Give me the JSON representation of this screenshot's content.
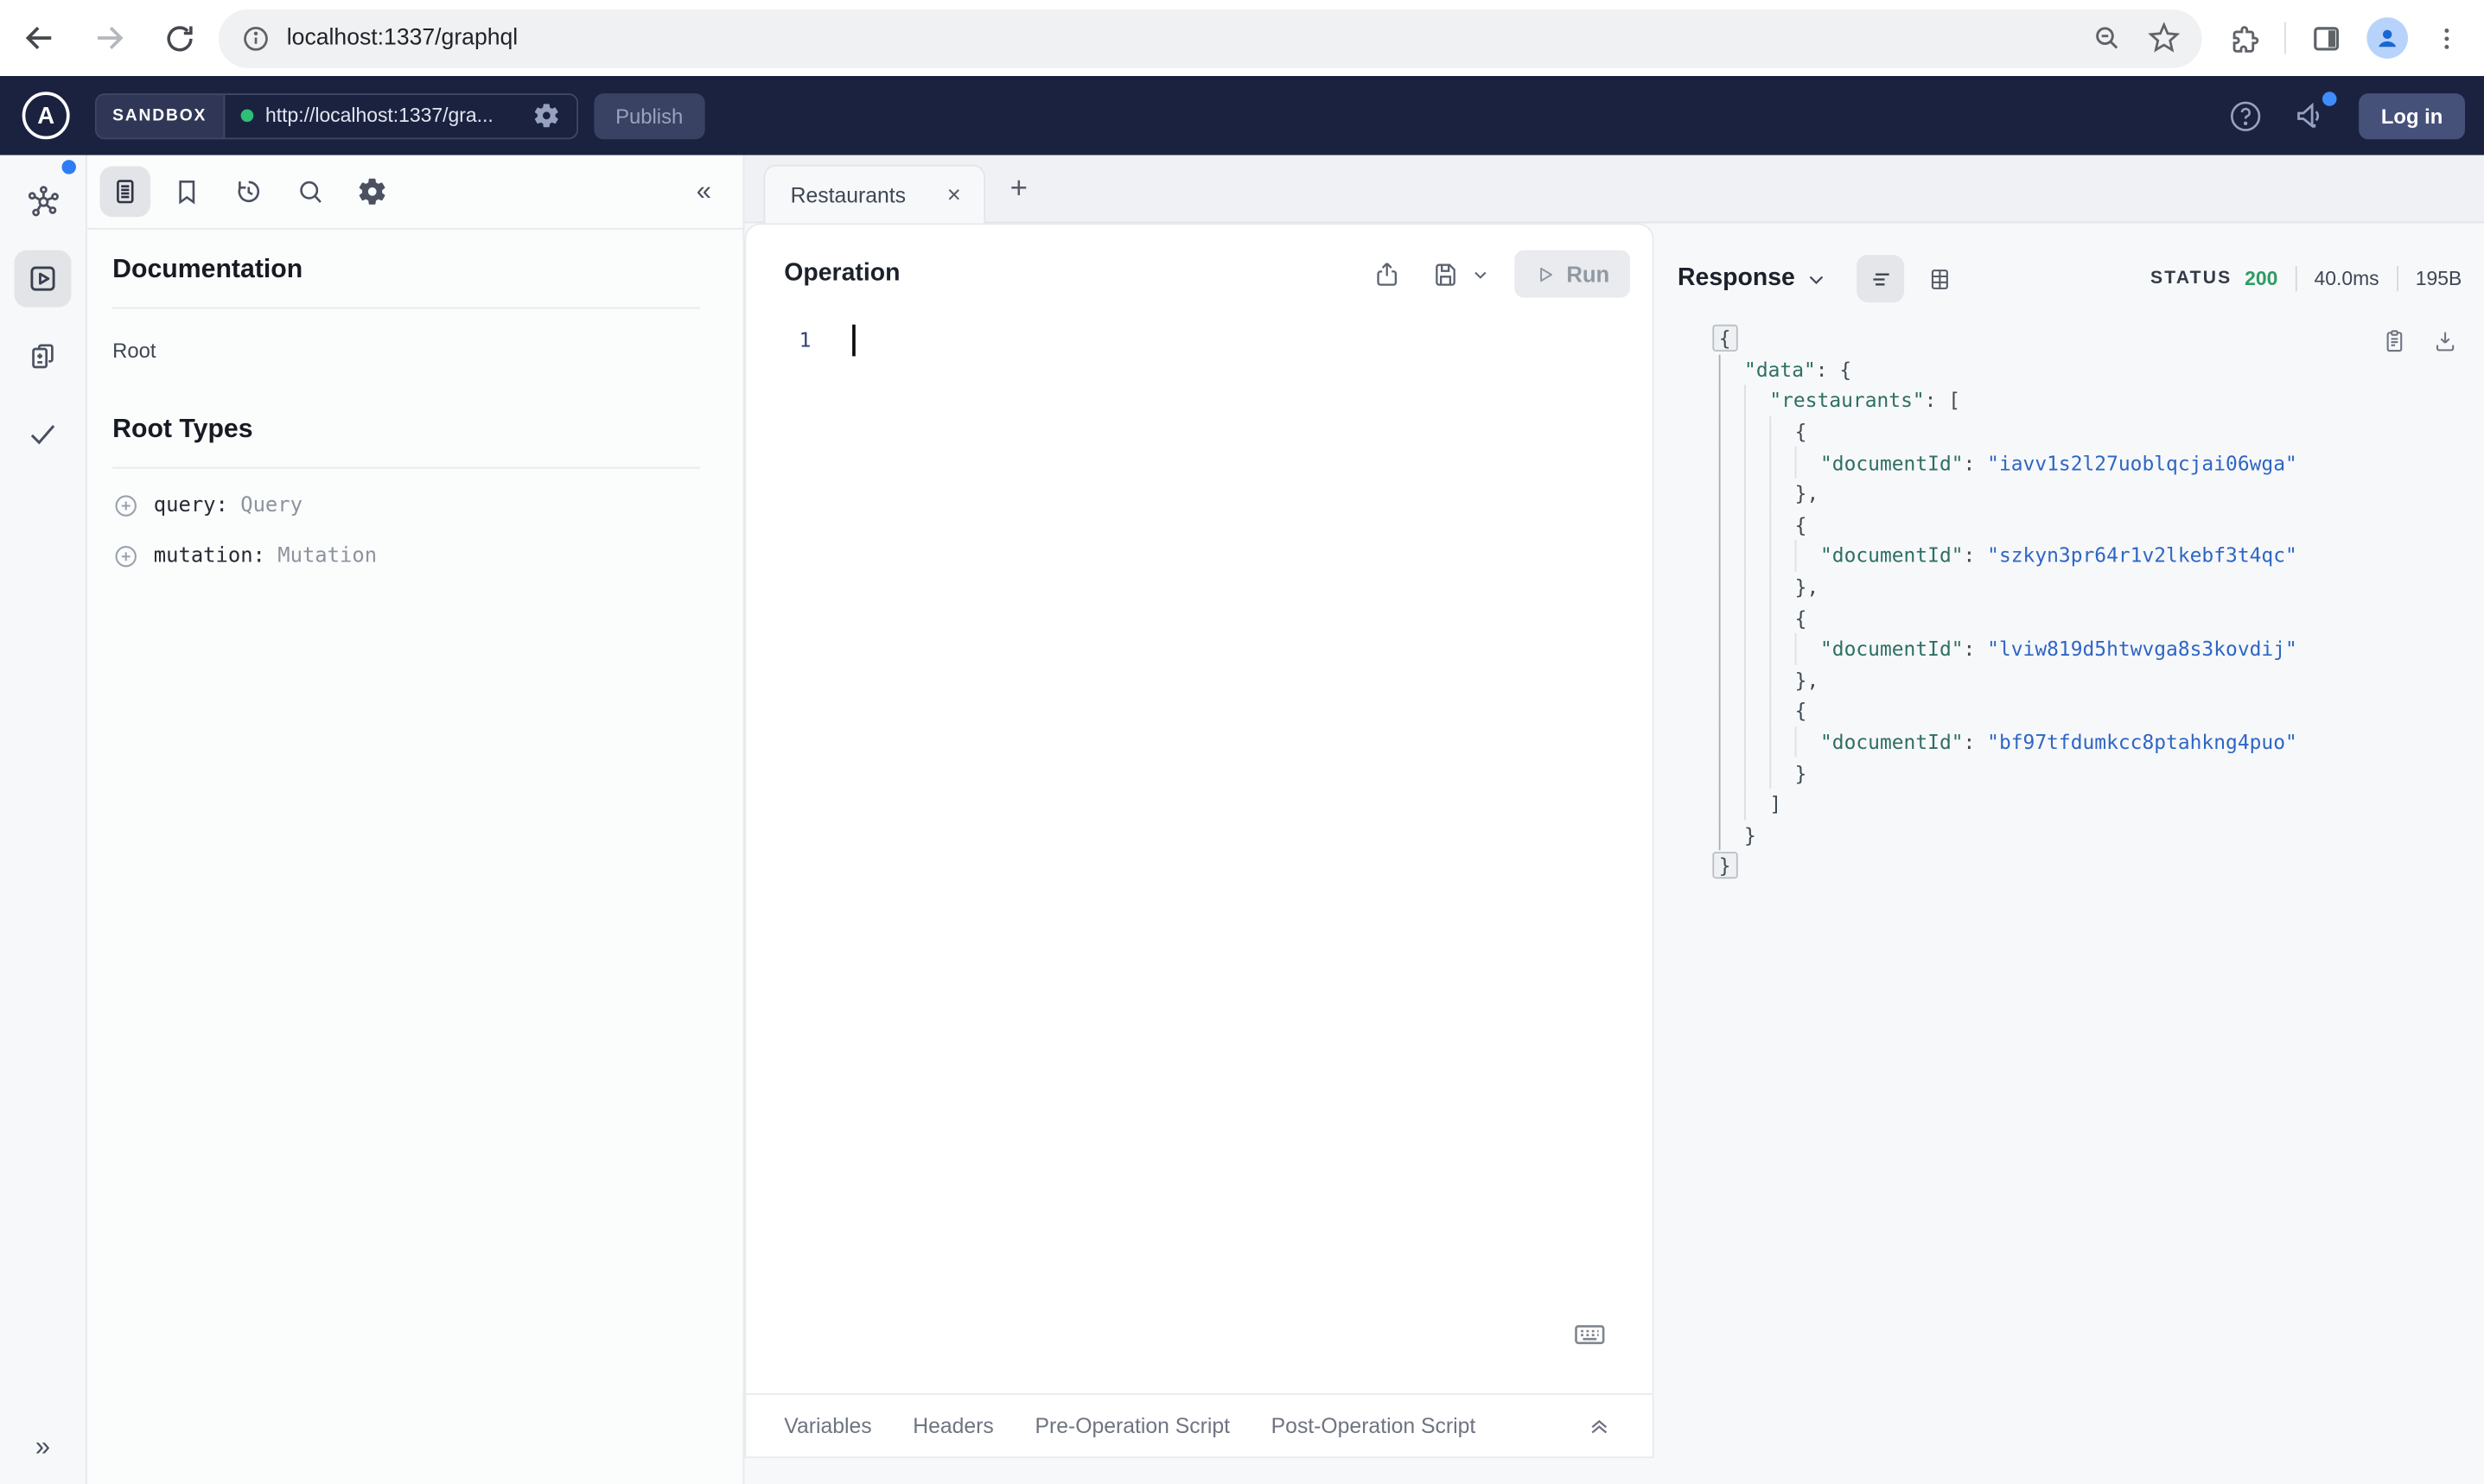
{
  "browser": {
    "url": "localhost:1337/graphql"
  },
  "header": {
    "brand_letter": "A",
    "badge": "SANDBOX",
    "endpoint": "http://localhost:1337/gra...",
    "publish": "Publish",
    "login": "Log in"
  },
  "docs": {
    "title": "Documentation",
    "root": "Root",
    "root_types": "Root Types",
    "types": [
      {
        "field": "query:",
        "type": "Query"
      },
      {
        "field": "mutation:",
        "type": "Mutation"
      }
    ]
  },
  "tabs": {
    "active": "Restaurants"
  },
  "operation": {
    "title": "Operation",
    "run": "Run",
    "line_number": "1"
  },
  "bottom_tabs": [
    "Variables",
    "Headers",
    "Pre-Operation Script",
    "Post-Operation Script"
  ],
  "response": {
    "title": "Response",
    "status_label": "STATUS",
    "status_code": "200",
    "time": "40.0ms",
    "size": "195B",
    "document_ids": [
      "iavv1s2l27uoblqcjai06wga",
      "szkyn3pr64r1v2lkebf3t4qc",
      "lviw819d5htwvga8s3kovdij",
      "bf97tfdumkcc8ptahkng4puo"
    ],
    "lines": [
      {
        "ind": 0,
        "seg": [
          {
            "c": "h",
            "t": "{"
          }
        ]
      },
      {
        "ind": 1,
        "seg": [
          {
            "c": "k",
            "t": "\"data\""
          },
          {
            "c": "p",
            "t": ": {"
          }
        ]
      },
      {
        "ind": 2,
        "seg": [
          {
            "c": "k",
            "t": "\"restaurants\""
          },
          {
            "c": "p",
            "t": ": ["
          }
        ]
      },
      {
        "ind": 3,
        "seg": [
          {
            "c": "p",
            "t": "{"
          }
        ]
      },
      {
        "ind": 4,
        "seg": [
          {
            "c": "k",
            "t": "\"documentId\""
          },
          {
            "c": "p",
            "t": ": "
          },
          {
            "c": "s",
            "t": "\"iavv1s2l27uoblqcjai06wga\""
          }
        ]
      },
      {
        "ind": 3,
        "seg": [
          {
            "c": "p",
            "t": "},"
          }
        ]
      },
      {
        "ind": 3,
        "seg": [
          {
            "c": "p",
            "t": "{"
          }
        ]
      },
      {
        "ind": 4,
        "seg": [
          {
            "c": "k",
            "t": "\"documentId\""
          },
          {
            "c": "p",
            "t": ": "
          },
          {
            "c": "s",
            "t": "\"szkyn3pr64r1v2lkebf3t4qc\""
          }
        ]
      },
      {
        "ind": 3,
        "seg": [
          {
            "c": "p",
            "t": "},"
          }
        ]
      },
      {
        "ind": 3,
        "seg": [
          {
            "c": "p",
            "t": "{"
          }
        ]
      },
      {
        "ind": 4,
        "seg": [
          {
            "c": "k",
            "t": "\"documentId\""
          },
          {
            "c": "p",
            "t": ": "
          },
          {
            "c": "s",
            "t": "\"lviw819d5htwvga8s3kovdij\""
          }
        ]
      },
      {
        "ind": 3,
        "seg": [
          {
            "c": "p",
            "t": "},"
          }
        ]
      },
      {
        "ind": 3,
        "seg": [
          {
            "c": "p",
            "t": "{"
          }
        ]
      },
      {
        "ind": 4,
        "seg": [
          {
            "c": "k",
            "t": "\"documentId\""
          },
          {
            "c": "p",
            "t": ": "
          },
          {
            "c": "s",
            "t": "\"bf97tfdumkcc8ptahkng4puo\""
          }
        ]
      },
      {
        "ind": 3,
        "seg": [
          {
            "c": "p",
            "t": "}"
          }
        ]
      },
      {
        "ind": 2,
        "seg": [
          {
            "c": "p",
            "t": "]"
          }
        ]
      },
      {
        "ind": 1,
        "seg": [
          {
            "c": "p",
            "t": "}"
          }
        ]
      },
      {
        "ind": 0,
        "seg": [
          {
            "c": "h",
            "t": "}"
          }
        ]
      }
    ]
  },
  "icons": {
    "close_tab": "×",
    "new_tab": "+",
    "collapse_left": "«",
    "expand_right": "»"
  },
  "colors": {
    "header_navy": "#1b2240",
    "accent_blue": "#2f7df6",
    "status_green": "#2e9b67",
    "json_key_teal": "#2e6f63",
    "json_string_blue": "#2e66c4",
    "endpoint_green_dot": "#2fbe76"
  }
}
